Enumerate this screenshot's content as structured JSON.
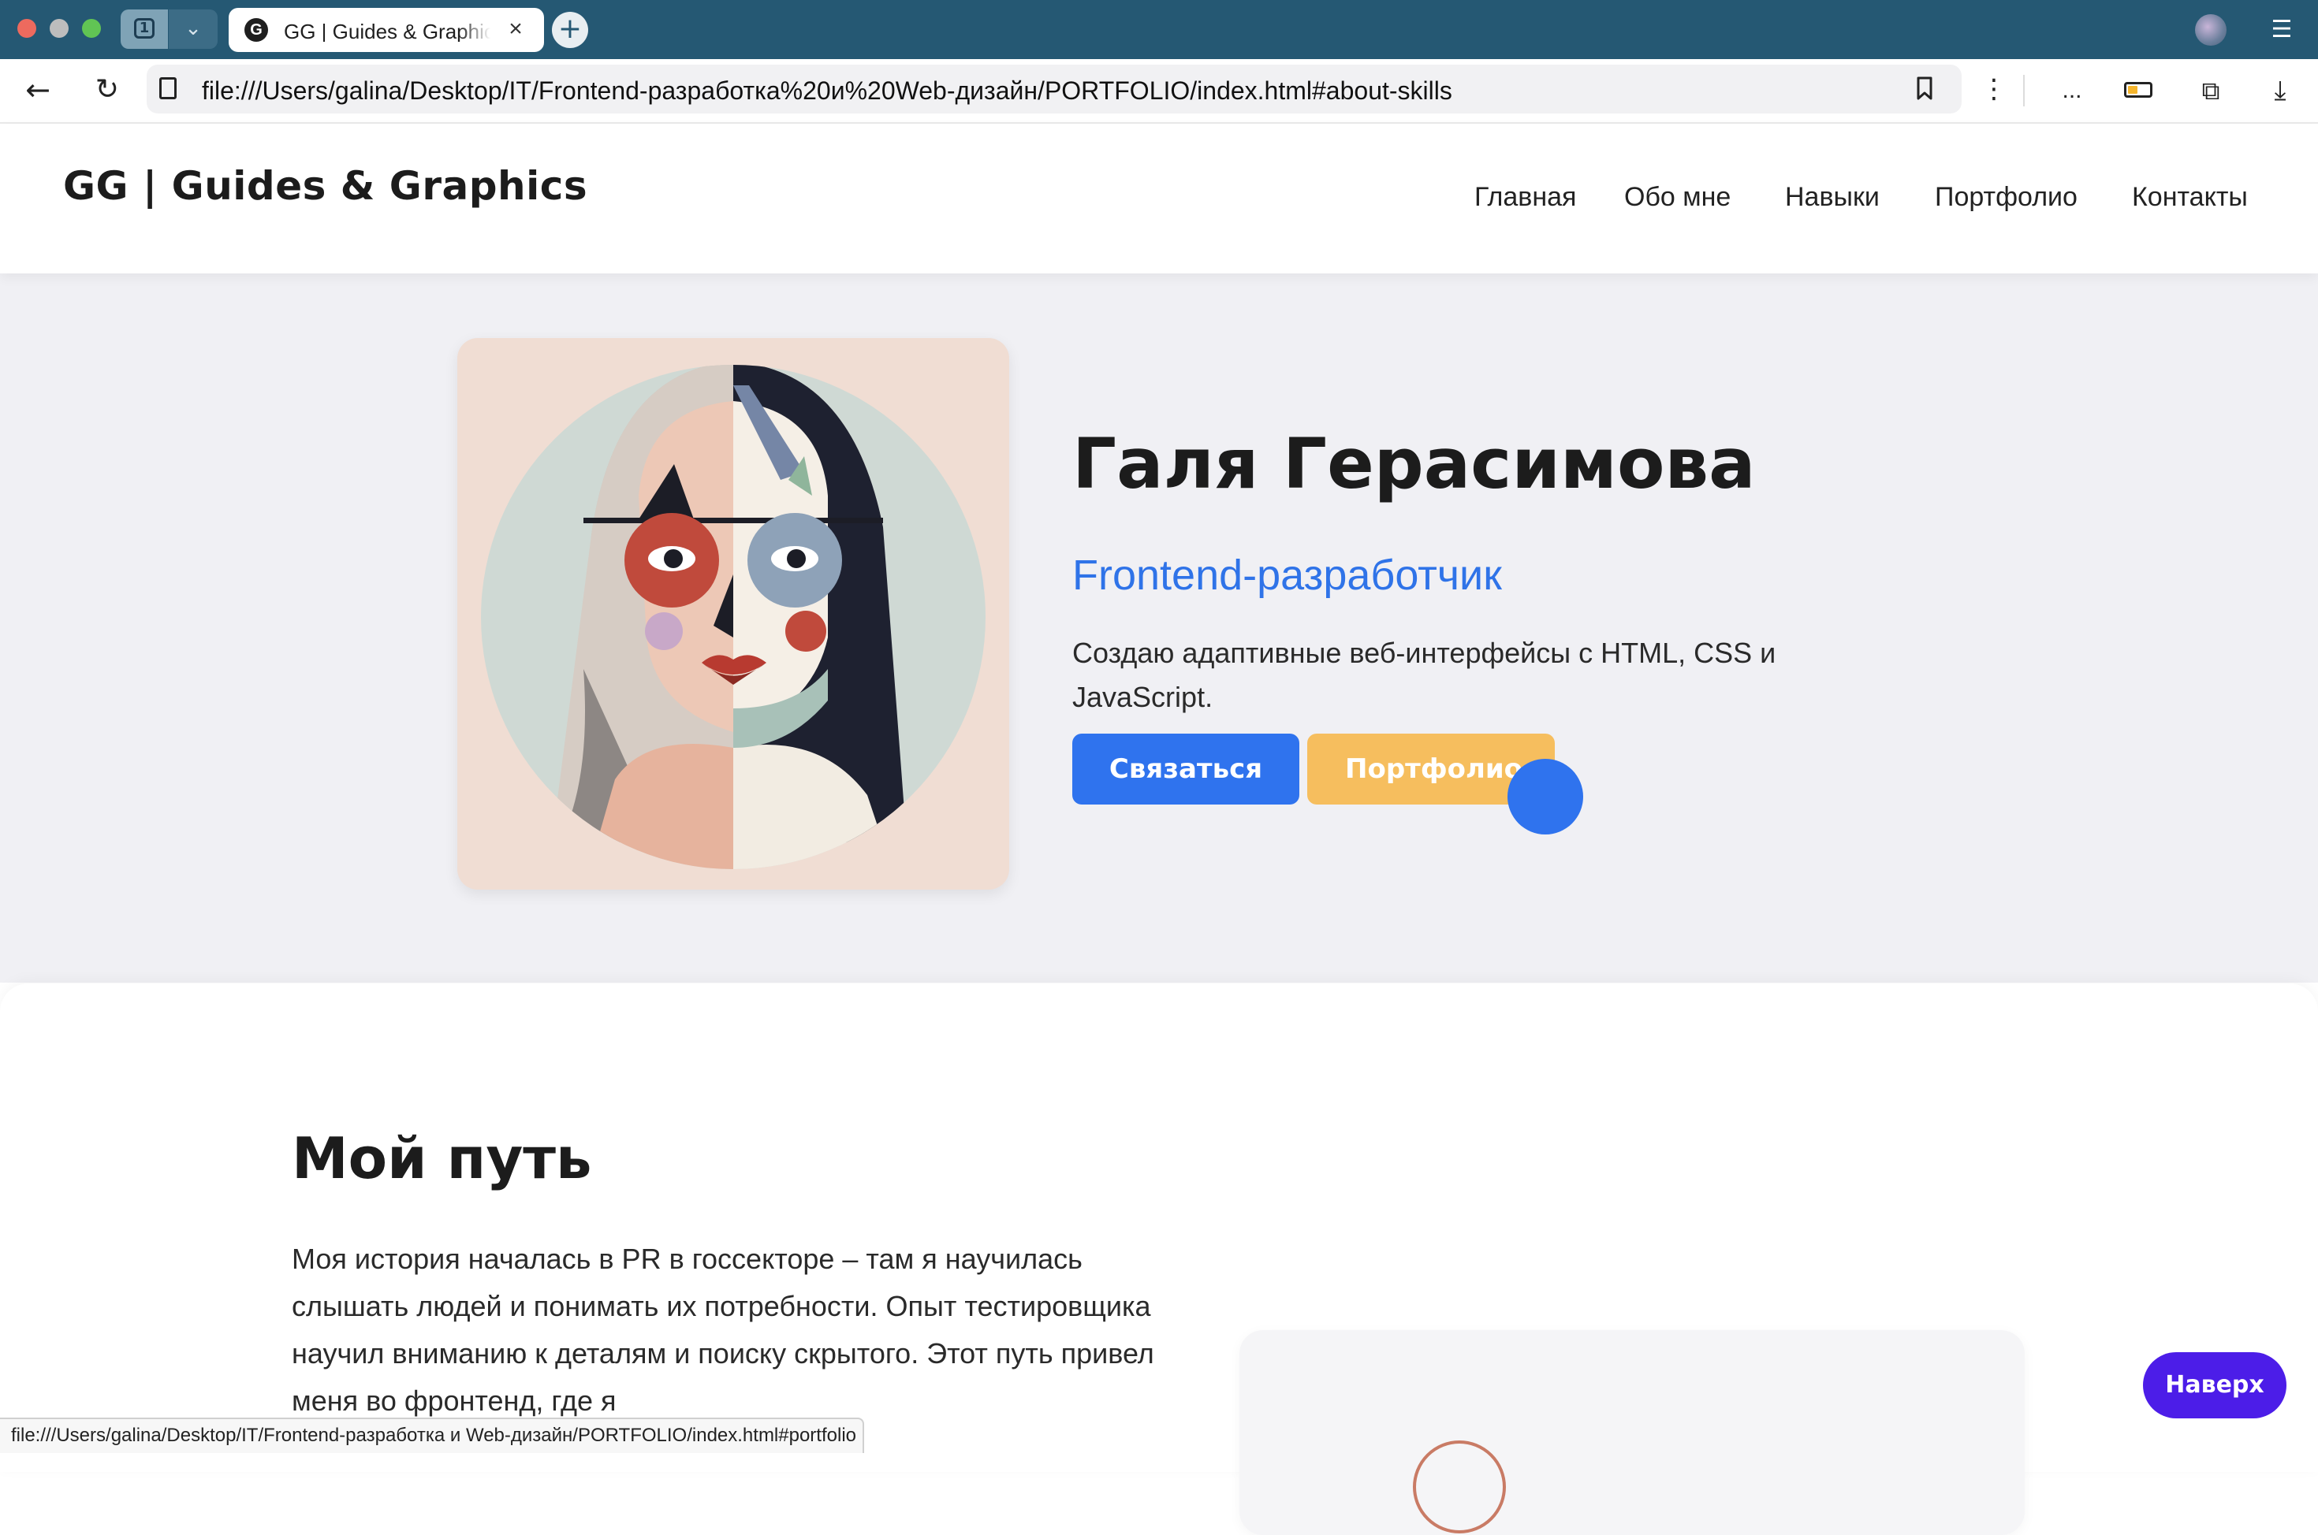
{
  "browser": {
    "tab_count": "1",
    "tab_title": "GG | Guides & Graphics",
    "tab_favicon": "G",
    "url": "file:///Users/galina/Desktop/IT/Frontend-разработка%20и%20Web-дизайн/PORTFOLIO/index.html#about-skills",
    "status_url": "file:///Users/galina/Desktop/IT/Frontend-разработка и Web-дизайн/PORTFOLIO/index.html#portfolio",
    "ellipsis": "...",
    "icons": {
      "close": "close-icon",
      "new_tab": "plus-icon",
      "back": "arrow-left-icon",
      "reload": "reload-icon",
      "bookmark": "bookmark-icon",
      "menu": "hamburger-icon",
      "download": "download-icon"
    }
  },
  "site": {
    "logo": "GG | Guides & Graphics",
    "nav": [
      "Главная",
      "Обо мне",
      "Навыки",
      "Портфолио",
      "Контакты"
    ]
  },
  "hero": {
    "name": "Галя Герасимова",
    "role": "Frontend-разработчик",
    "description": "Создаю адаптивные веб-интерфейсы с HTML, CSS и JavaScript.",
    "contact_button": "Связаться",
    "portfolio_button": "Портфолио"
  },
  "about": {
    "title": "Мой путь",
    "text": "Моя история началась в PR в госсекторе – там я научилась слышать людей и понимать их потребности. Опыт тестировщика научил вниманию к деталям и поиску скрытого. Этот путь привел меня во фронтенд, где я"
  },
  "scroll_top": "Наверх",
  "colors": {
    "tabstrip": "#255873",
    "accent_blue": "#2f73ee",
    "accent_yellow": "#f6be5e",
    "scroll_button": "#4c1de8",
    "hero_bg": "#f0f0f4"
  }
}
